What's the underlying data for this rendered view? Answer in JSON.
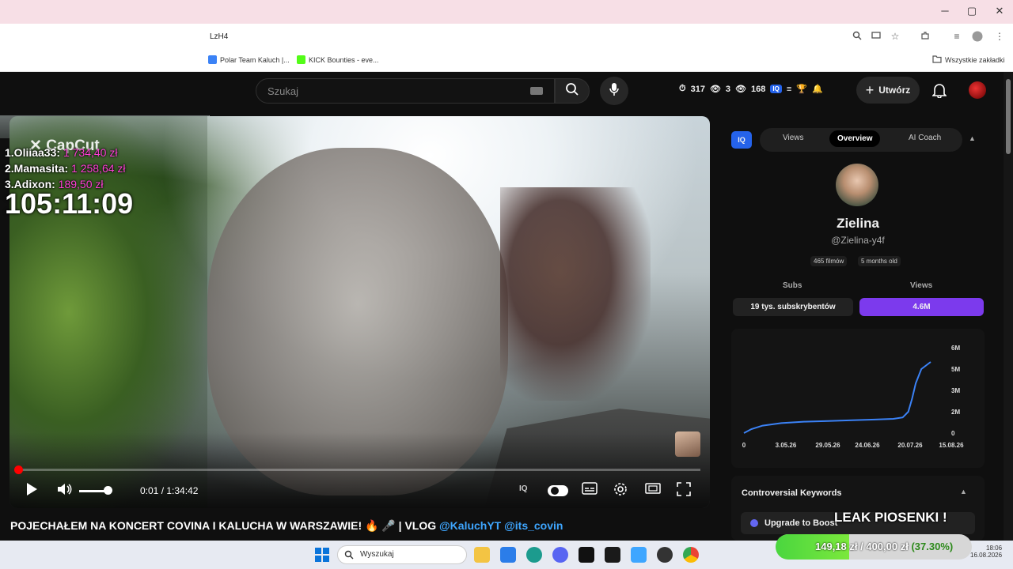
{
  "browser": {
    "url_fragment": "LzH4",
    "window_controls": [
      "─",
      "▢",
      "✕"
    ],
    "bookmarks": [
      {
        "label": "Polar Team Kaluch |...",
        "color": "#3b82f6"
      },
      {
        "label": "KICK Bounties - eve...",
        "color": "#53fc18"
      }
    ],
    "all_bookmarks": "Wszystkie zakładki"
  },
  "youtube": {
    "search_placeholder": "Szukaj",
    "stats": {
      "clock_value": "317",
      "eye_value_1": "3",
      "eye_value_2": "168"
    },
    "create_label": "Utwórz"
  },
  "video": {
    "current_time": "0:01",
    "duration": "1:34:42",
    "time_display": "0:01 / 1:34:42",
    "progress_fraction": 0.0002,
    "volume_fraction": 0.8,
    "title_prefix": "POJECHAŁEM NA KONCERT COVINA I KALUCHA W WARSZAWIE! 🔥 🎤 | VLOG ",
    "title_links": [
      "@KaluchYT",
      "@its_covin"
    ]
  },
  "panel": {
    "iq_label": "IQ",
    "tabs": [
      "Views",
      "Overview",
      "AI Coach"
    ],
    "active_tab": "Overview",
    "channel_name": "Zielina",
    "handle": "@Zielina-y4f",
    "videos_count": "465 filmów",
    "age": "5 months old",
    "subs_header": "Subs",
    "views_header": "Views",
    "subs_value": "19 tys. subskrybentów",
    "views_value": "4.6M",
    "accent": "#7c3aed",
    "chart_data": {
      "type": "line",
      "x_ticks": [
        "0",
        "3.05.26",
        "29.05.26",
        "24.06.26",
        "20.07.26",
        "15.08.26"
      ],
      "y_ticks": [
        "6M",
        "5M",
        "3M",
        "2M",
        "0"
      ],
      "ylim": [
        0,
        6000000
      ],
      "series": [
        {
          "color": "#3b82f6",
          "points": [
            [
              0,
              0
            ],
            [
              0.04,
              280000
            ],
            [
              0.1,
              520000
            ],
            [
              0.2,
              700000
            ],
            [
              0.32,
              800000
            ],
            [
              0.45,
              850000
            ],
            [
              0.58,
              900000
            ],
            [
              0.7,
              950000
            ],
            [
              0.8,
              1000000
            ],
            [
              0.85,
              1100000
            ],
            [
              0.88,
              1500000
            ],
            [
              0.9,
              2400000
            ],
            [
              0.92,
              3500000
            ],
            [
              0.95,
              4500000
            ],
            [
              1.0,
              5000000
            ]
          ]
        }
      ],
      "grid": false,
      "legend": "none"
    },
    "keywords_title": "Controversial Keywords",
    "boost_label": "Upgrade to Boost"
  },
  "overlay": {
    "capcut": "✕ CapCut",
    "donors": [
      {
        "rank": "1.Oliiaa33:",
        "amount": "1 734,40 zł"
      },
      {
        "rank": "2.Mamasita:",
        "amount": "1 258,64 zł"
      },
      {
        "rank": "3.Adixon:",
        "amount": "189,50 zł"
      }
    ],
    "timer": "105:11:09",
    "leak_text": "LEAK PIOSENKI !",
    "goal_current": "149,18 zł",
    "goal_target": "/ 400,00 zł",
    "goal_percent_text": "(37.30%)",
    "goal_fraction": 0.373
  },
  "taskbar": {
    "search_label": "Wyszukaj",
    "time": "18:06",
    "date": "16.08.2026"
  }
}
